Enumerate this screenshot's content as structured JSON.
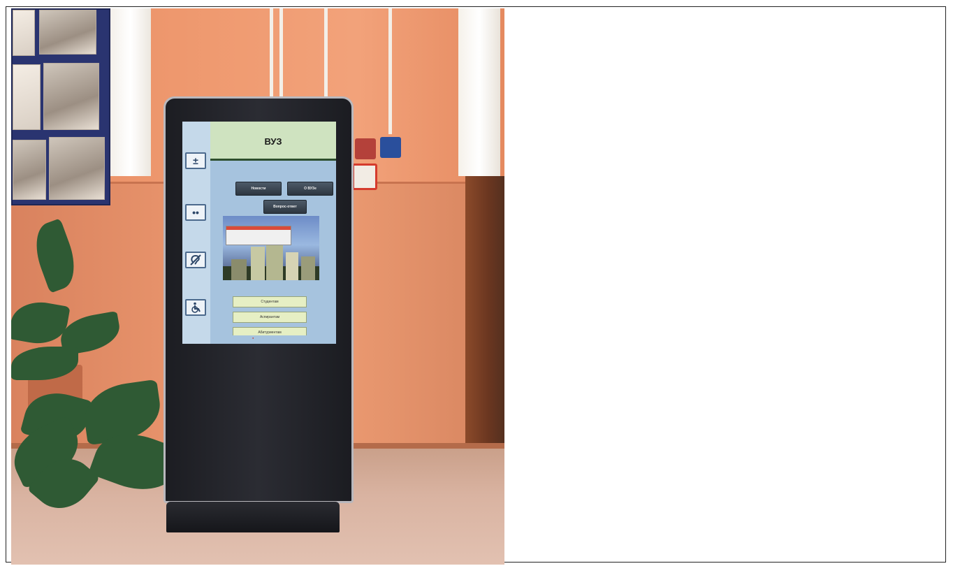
{
  "photo": {
    "kiosk": {
      "header_title": "ВУЗ",
      "buttons_top": [
        "Новости",
        "О ВУЗе"
      ],
      "button_mid": "Вопрос-ответ",
      "buttons_bottom": [
        "Студентам",
        "Аспирантам",
        "Абитуриентам"
      ],
      "side_icons": [
        "plus-minus-icon",
        "eyes-icon",
        "hearing-icon",
        "wheelchair-icon"
      ]
    }
  }
}
